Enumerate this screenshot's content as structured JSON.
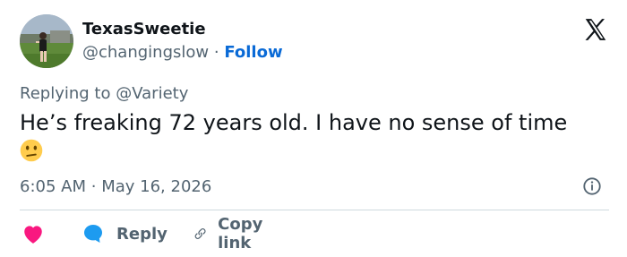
{
  "author": {
    "display_name": "TexasSweetie",
    "handle": "@changingslow",
    "separator": "·",
    "follow_label": "Follow"
  },
  "tweet": {
    "replying_to_label": "Replying to",
    "replying_to_handle": "@Variety",
    "text": "He’s freaking 72 years old. I have no sense of time",
    "emoji": "confused-face",
    "time": "6:05 AM",
    "meta_separator": "·",
    "date": "May 16, 2026"
  },
  "actions": {
    "like_icon": "heart-icon",
    "reply_label": "Reply",
    "copy_link_label": "Copy link"
  },
  "colors": {
    "like": "#f91880",
    "reply_bubble": "#1d9bf0",
    "follow": "#0a6ad6",
    "secondary_text": "#536471"
  }
}
